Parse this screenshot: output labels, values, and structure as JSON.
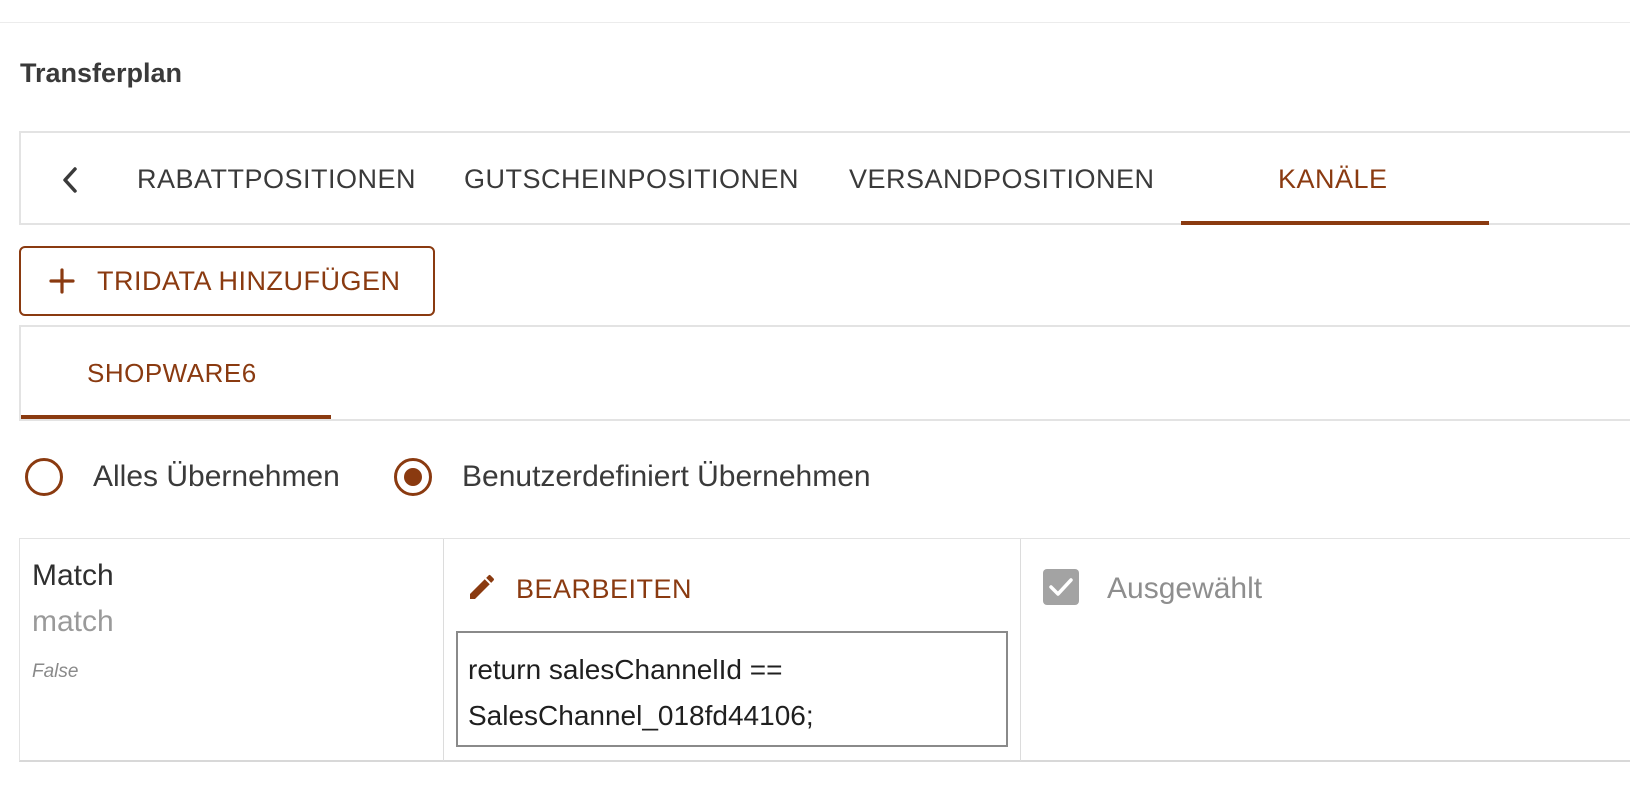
{
  "section_title": "Transferplan",
  "tabs": [
    {
      "label": "RABATTPOSITIONEN"
    },
    {
      "label": "GUTSCHEINPOSITIONEN"
    },
    {
      "label": "VERSANDPOSITIONEN"
    },
    {
      "label": "KANÄLE"
    }
  ],
  "active_tab": "KANÄLE",
  "add_button_label": "TRIDATA HINZUFÜGEN",
  "channel_tab": {
    "label": "SHOPWARE6"
  },
  "radio_options": [
    {
      "label": "Alles Übernehmen",
      "selected": false
    },
    {
      "label": "Benutzerdefiniert Übernehmen",
      "selected": true
    }
  ],
  "row": {
    "title": "Match",
    "key": "match",
    "default": "False",
    "edit_label": "BEARBEITEN",
    "code": "return salesChannelId ==\nSalesChannel_018fd44106;",
    "checkbox_label": "Ausgewählt",
    "checkbox_checked": true
  },
  "colors": {
    "accent": "#8a3a10",
    "border": "#e3e3e3",
    "checkbox": "#a3a3a3"
  }
}
